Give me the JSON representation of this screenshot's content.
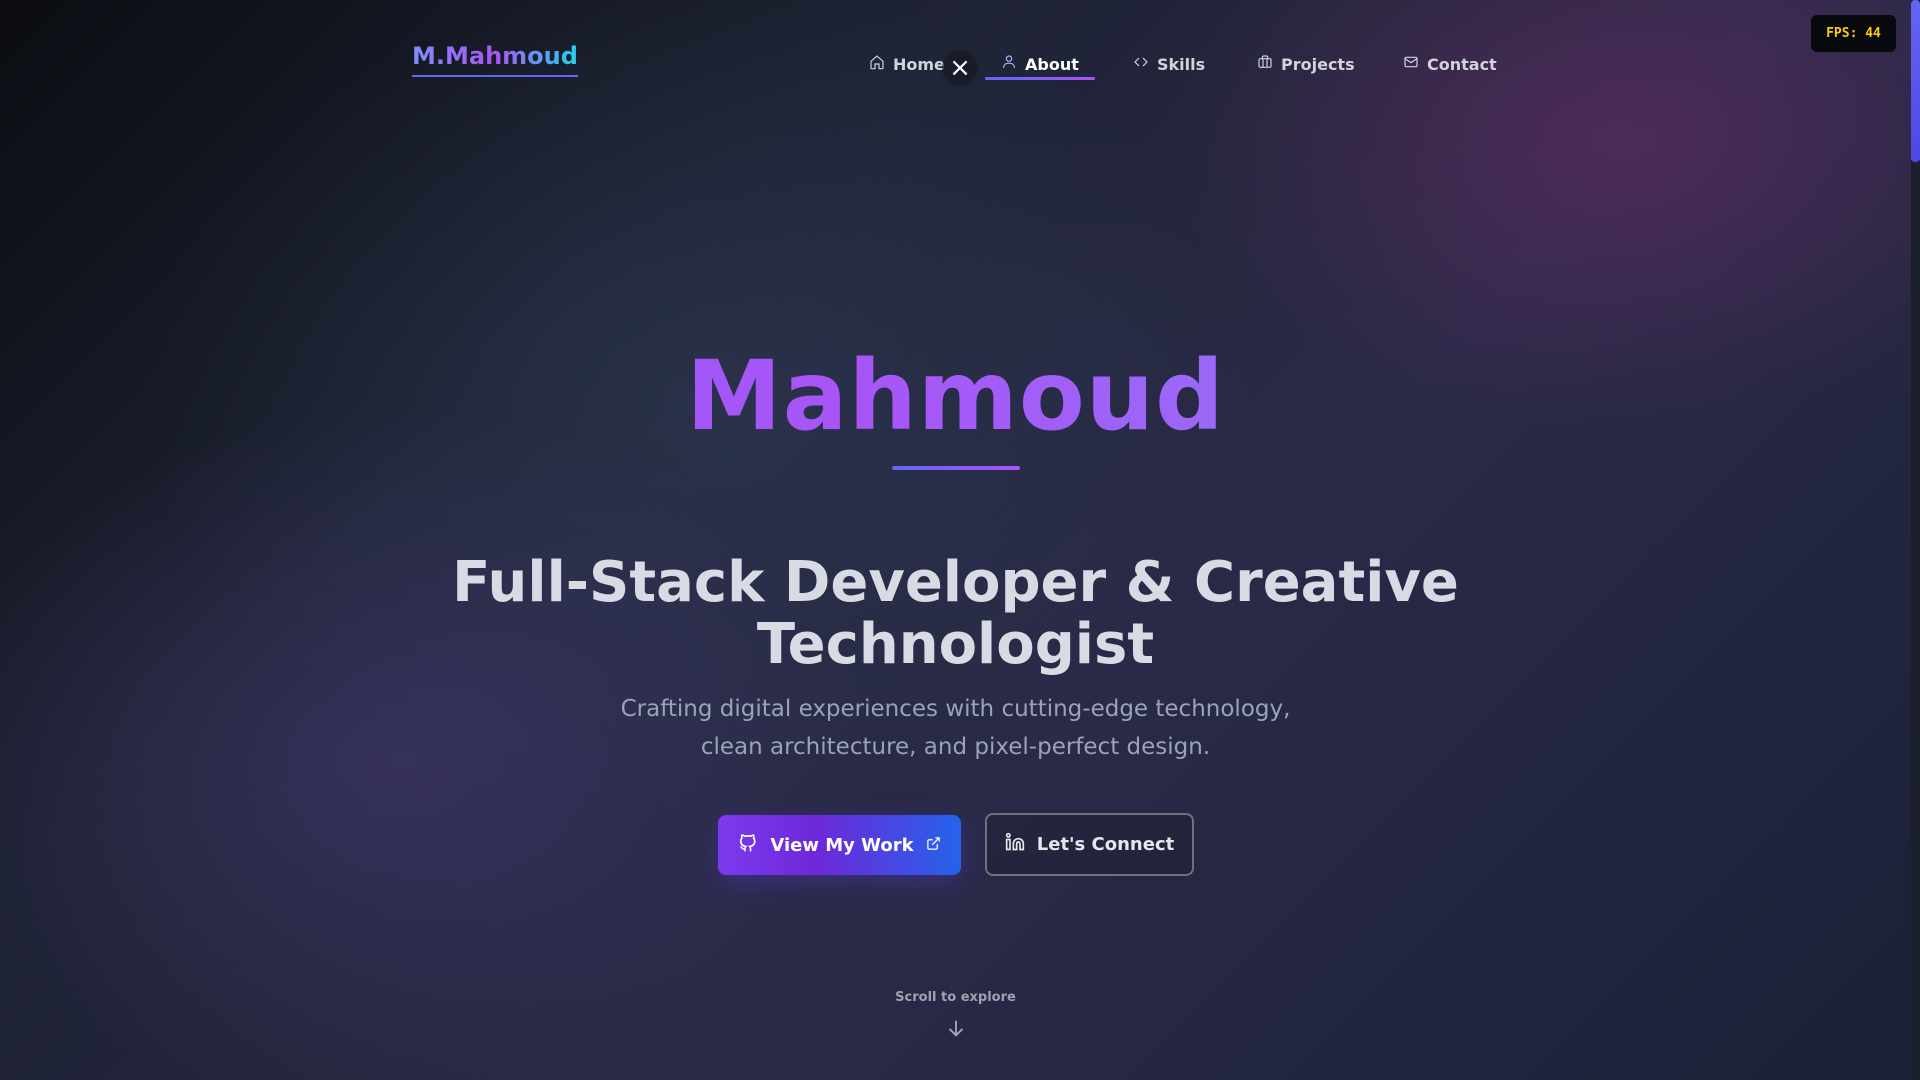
{
  "brand": {
    "logo": "M.Mahmoud"
  },
  "nav": {
    "items": [
      {
        "label": "Home",
        "icon": "home-icon"
      },
      {
        "label": "About",
        "icon": "user-icon",
        "active": true
      },
      {
        "label": "Skills",
        "icon": "code-icon"
      },
      {
        "label": "Projects",
        "icon": "briefcase-icon"
      },
      {
        "label": "Contact",
        "icon": "mail-icon"
      }
    ],
    "close_symbol": "×"
  },
  "fps": {
    "text": "FPS: 44"
  },
  "hero": {
    "name": "Mahmoud",
    "title_line1": "Full-Stack Developer & Creative",
    "title_line2": "Technologist",
    "subtitle_line1": "Crafting digital experiences with cutting-edge technology,",
    "subtitle_line2": "clean architecture, and pixel-perfect design.",
    "primary_button": {
      "label": "View My Work",
      "icon": "github-icon",
      "trailing_icon": "external-link-icon"
    },
    "secondary_button": {
      "label": "Let's Connect",
      "icon": "linkedin-icon"
    },
    "scroll_hint": "Scroll to explore"
  },
  "colors": {
    "accent_purple": "#a855f7",
    "accent_indigo": "#6366f1",
    "accent_blue": "#2563eb",
    "fps_text": "#facc15"
  }
}
